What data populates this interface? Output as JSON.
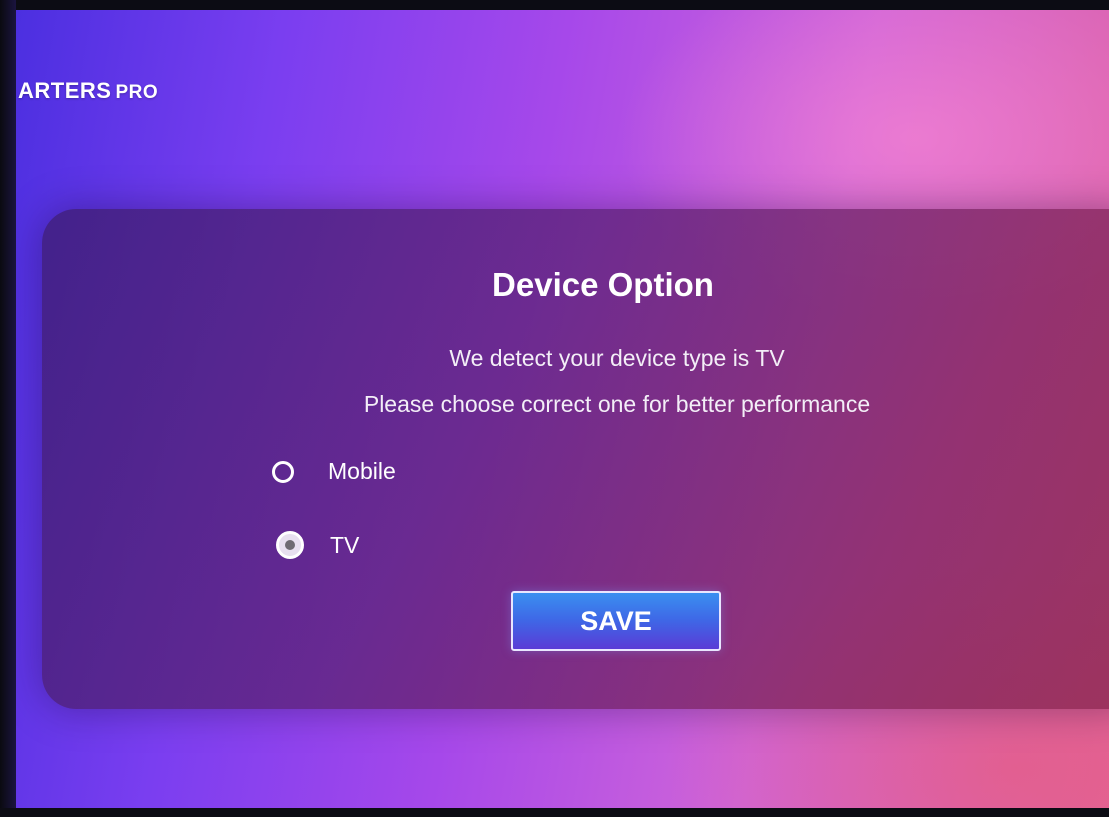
{
  "brand": {
    "name": "ARTERS",
    "suffix": "PRO"
  },
  "dialog": {
    "title": "Device Option",
    "message_line1": "We detect your device type is TV",
    "message_line2": "Please choose correct one for better performance",
    "options": [
      {
        "label": "Mobile",
        "selected": false
      },
      {
        "label": "TV",
        "selected": true
      }
    ],
    "save_label": "SAVE"
  },
  "colors": {
    "accent_button": "#3f66e6",
    "dialog_background": "#5a2278"
  }
}
